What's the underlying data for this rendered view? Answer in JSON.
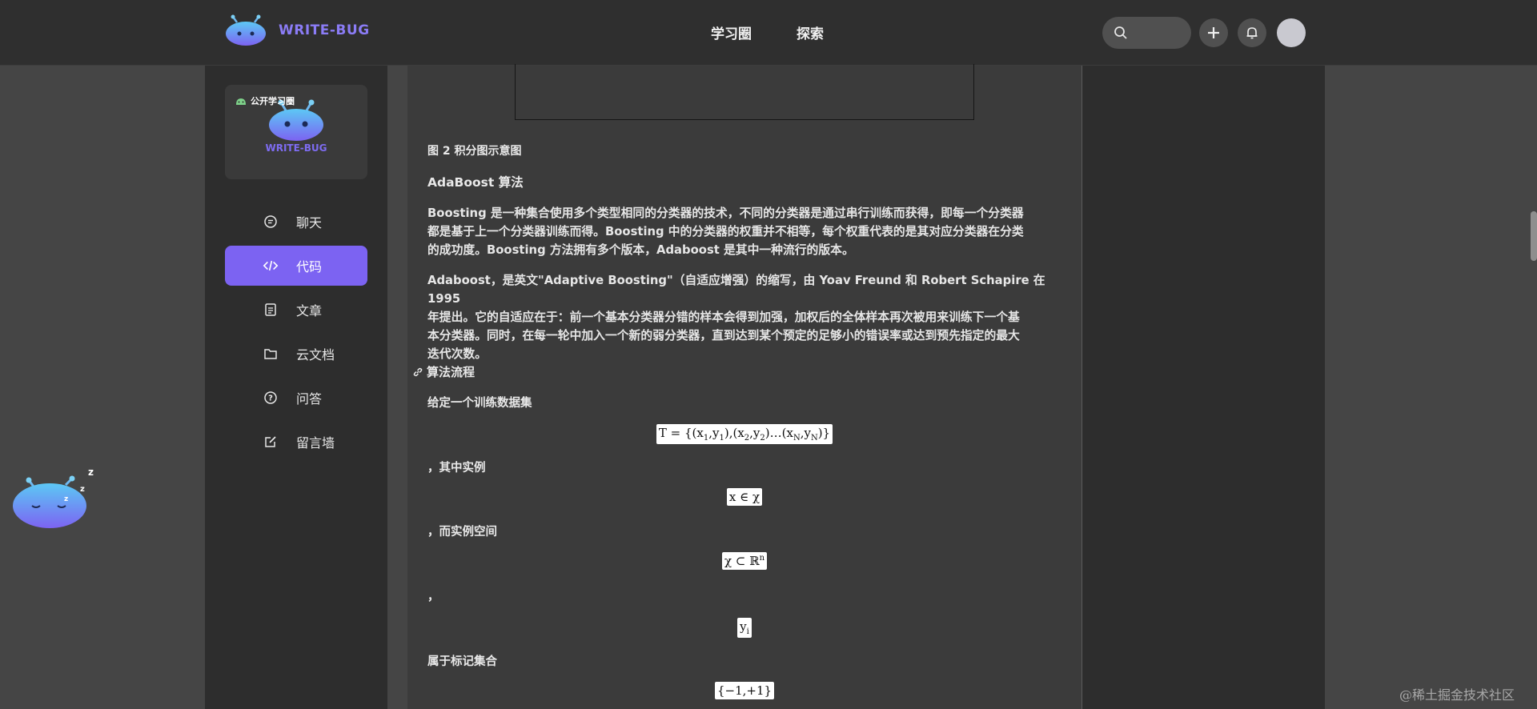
{
  "header": {
    "brand": "WRITE-BUG",
    "nav": [
      "学习圈",
      "探索"
    ],
    "icons": [
      "search-icon",
      "plus-icon",
      "bell-icon",
      "avatar"
    ]
  },
  "sidebar": {
    "group_badge": "公开学习圈",
    "group_logo_text": "WRITE-BUG",
    "items": [
      {
        "label": "聊天",
        "icon": "chat-icon"
      },
      {
        "label": "代码",
        "icon": "code-icon",
        "active": true
      },
      {
        "label": "文章",
        "icon": "article-icon"
      },
      {
        "label": "云文档",
        "icon": "folder-icon"
      },
      {
        "label": "问答",
        "icon": "question-icon"
      },
      {
        "label": "留言墙",
        "icon": "edit-icon"
      }
    ]
  },
  "article": {
    "figure_caption": "图 2 积分图示意图",
    "heading_adaboost": "AdaBoost 算法",
    "para1_lines": [
      "Boosting 是一种集合使用多个类型相同的分类器的技术，不同的分类器是通过串行训练而获得，即每一个分类器",
      "都是基于上一个分类器训练而得。Boosting 中的分类器的权重并不相等，每个权重代表的是其对应分类器在分类",
      "的成功度。Boosting 方法拥有多个版本，Adaboost 是其中一种流行的版本。"
    ],
    "para2_lines": [
      "Adaboost，是英文\"Adaptive Boosting\"（自适应增强）的缩写，由 Yoav Freund 和 Robert Schapire 在 1995",
      "年提出。它的自适应在于：前一个基本分类器分错的样本会得到加强，加权后的全体样本再次被用来训练下一个基",
      "本分类器。同时，在每一轮中加入一个新的弱分类器，直到达到某个预定的足够小的错误率或达到预先指定的最大",
      "迭代次数。"
    ],
    "heading_flow": "算法流程",
    "line_given": "给定一个训练数据集",
    "math_T": "T = {(x1,y1),(x2,y2)…(xN,yN)}",
    "line_instance": "，其中实例",
    "math_x": "x ∈ χ",
    "line_space": "，而实例空间",
    "math_chi": "χ ⊂ ℝn",
    "line_comma": "，",
    "math_y": "yi",
    "line_labels": "属于标记集合",
    "math_set": "{−1,+1}"
  },
  "watermark": "@稀土掘金技术社区",
  "colors": {
    "accent": "#7c63f2",
    "topbar": "#2f2f2f",
    "background": "#454545",
    "article_bg": "#3b3b3b"
  }
}
